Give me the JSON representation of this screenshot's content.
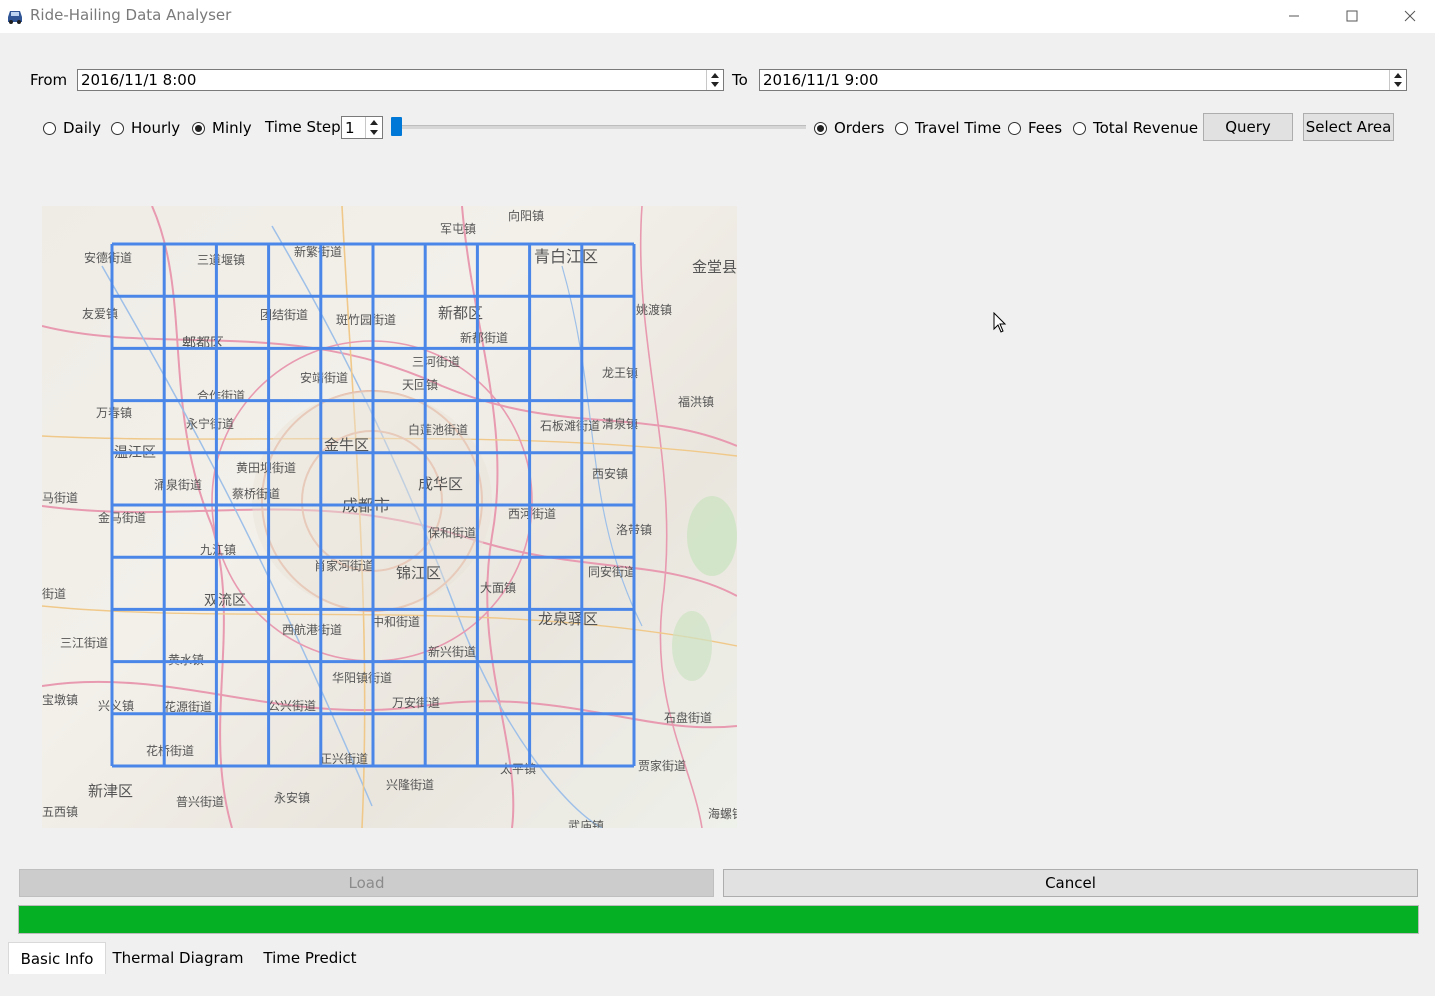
{
  "window": {
    "title": "Ride-Hailing Data Analyser"
  },
  "range": {
    "from_label": "From",
    "from_value": "2016/11/1 8:00",
    "to_label": "To",
    "to_value": "2016/11/1 9:00"
  },
  "granularity": {
    "options": [
      "Daily",
      "Hourly",
      "Minly"
    ],
    "selected": "Minly"
  },
  "time_step": {
    "label": "Time Step",
    "value": "1",
    "slider_level": 0.0
  },
  "metric": {
    "options": [
      "Orders",
      "Travel Time",
      "Fees",
      "Total Revenue"
    ],
    "selected": "Orders"
  },
  "buttons": {
    "query": "Query",
    "select_area": "Select Area",
    "load": "Load",
    "cancel": "Cancel"
  },
  "progress": {
    "percent": 100,
    "color": "#06b025"
  },
  "tabs": [
    "Basic Info",
    "Thermal Diagram",
    "Time Predict"
  ],
  "active_tab": "Basic Info",
  "map": {
    "grid": {
      "rows": 10,
      "cols": 10,
      "color": "#4a86e8"
    },
    "labels": [
      "向阳镇",
      "军屯镇",
      "安德街道",
      "三道堰镇",
      "新繁街道",
      "青白江区",
      "金堂县",
      "友爱镇",
      "团结街道",
      "斑竹园街道",
      "新都区",
      "新都街道",
      "姚渡镇",
      "郫都区",
      "三河街道",
      "安靖街道",
      "天回镇",
      "龙王镇",
      "合作街道",
      "万春镇",
      "永宁街道",
      "清泉镇",
      "福洪镇",
      "白莲池街道",
      "石板滩街道",
      "温江区",
      "金牛区",
      "黄田坝街道",
      "西安镇",
      "马街道",
      "涌泉街道",
      "蔡桥街道",
      "成华区",
      "成都市",
      "金马街道",
      "西河街道",
      "保和街道",
      "洛带镇",
      "九江镇",
      "肖家河街道",
      "锦江区",
      "大面镇",
      "同安街道",
      "街道",
      "双流区",
      "中和街道",
      "龙泉驿区",
      "三江街道",
      "西航港街道",
      "黄水镇",
      "新兴街道",
      "华阳镇街道",
      "宝墩镇",
      "兴义镇",
      "花源街道",
      "公兴街道",
      "万安街道",
      "石盘街道",
      "花桥街道",
      "正兴街道",
      "太平镇",
      "贾家街道",
      "新津区",
      "兴隆街道",
      "普兴街道",
      "永安镇",
      "五西镇",
      "海螺镇",
      "武庙镇"
    ]
  }
}
